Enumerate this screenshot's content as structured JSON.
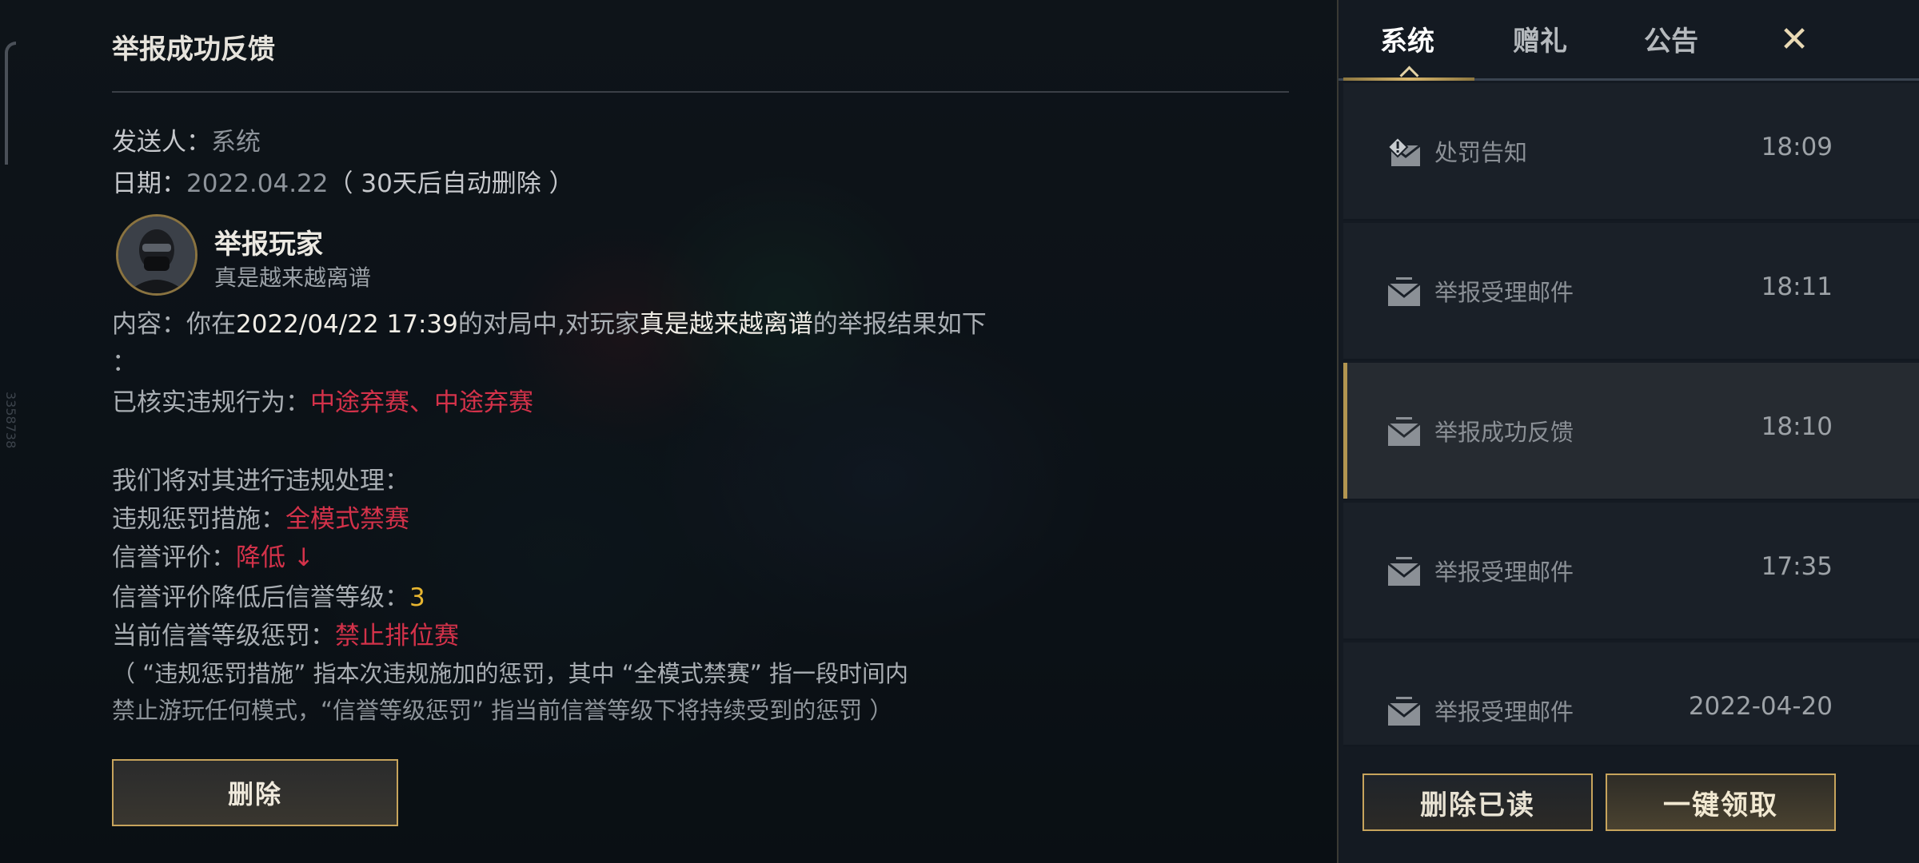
{
  "detail": {
    "title": "举报成功反馈",
    "sender_label": "发送人：",
    "sender_value": "系统",
    "date_label": "日期：",
    "date_value": "2022.04.22",
    "date_note": "（ 30天后自动删除 ）",
    "reported_player_heading": "举报玩家",
    "reported_player_name": "真是越来越离谱",
    "content_prefix": "内容：你在",
    "content_datetime": "2022/04/22 17:39",
    "content_mid": "的对局中,对玩家",
    "content_player": "真是越来越离谱",
    "content_suffix": "的举报结果如下",
    "content_colon": "：",
    "violation_label": "已核实违规行为：",
    "violation_value": "中途弃赛、中途弃赛",
    "handling_line": "我们将对其进行违规处理：",
    "penalty_label": "违规惩罚措施：",
    "penalty_value": "全模式禁赛",
    "credit_label": "信誉评价：",
    "credit_value": "降低 ↓",
    "credit_level_label": "信誉评价降低后信誉等级：",
    "credit_level_value": "3",
    "current_penalty_label": "当前信誉等级惩罚：",
    "current_penalty_value": "禁止排位赛",
    "note_line1": "（ “违规惩罚措施” 指本次违规施加的惩罚，其中 “全模式禁赛” 指一段时间内",
    "note_line2": "禁止游玩任何模式，“信誉等级惩罚” 指当前信誉等级下将持续受到的惩罚 ）",
    "delete_button": "删除"
  },
  "side_id": "3358738",
  "panel": {
    "tabs": [
      {
        "label": "系统",
        "active": true
      },
      {
        "label": "赠礼",
        "active": false
      },
      {
        "label": "公告",
        "active": false
      }
    ],
    "close_icon": "close-icon",
    "mails": [
      {
        "title": "处罚告知",
        "time": "18:09",
        "icon": "warning-mail-icon",
        "selected": false
      },
      {
        "title": "举报受理邮件",
        "time": "18:11",
        "icon": "mail-icon",
        "selected": false
      },
      {
        "title": "举报成功反馈",
        "time": "18:10",
        "icon": "mail-icon",
        "selected": true
      },
      {
        "title": "举报受理邮件",
        "time": "17:35",
        "icon": "mail-icon",
        "selected": false
      },
      {
        "title": "举报受理邮件",
        "time": "2022-04-20",
        "icon": "mail-icon",
        "selected": false
      }
    ],
    "delete_read_button": "删除已读",
    "collect_all_button": "一键领取"
  },
  "colors": {
    "accent_gold": "#c7a45c",
    "highlight_red": "#d4324a",
    "highlight_yellow": "#e8b630"
  }
}
